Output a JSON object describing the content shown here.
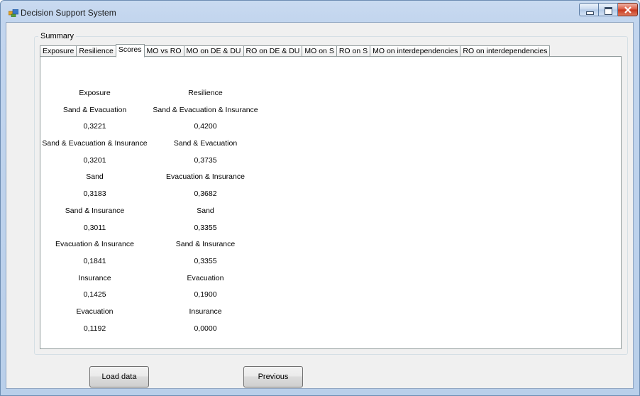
{
  "window": {
    "title": "Decision Support System"
  },
  "group": {
    "label": "Summary"
  },
  "tabs": [
    {
      "label": "Exposure"
    },
    {
      "label": "Resilience"
    },
    {
      "label": "Scores",
      "active": true
    },
    {
      "label": "MO vs RO"
    },
    {
      "label": "MO on DE & DU"
    },
    {
      "label": "RO on DE & DU"
    },
    {
      "label": "MO on S"
    },
    {
      "label": "RO on S"
    },
    {
      "label": "MO on interdependencies"
    },
    {
      "label": "RO on interdependencies"
    }
  ],
  "scores": {
    "exposure": {
      "header": "Exposure",
      "rows": [
        {
          "name": "Sand & Evacuation",
          "value": "0,3221"
        },
        {
          "name": "Sand & Evacuation & Insurance",
          "value": "0,3201"
        },
        {
          "name": "Sand",
          "value": "0,3183"
        },
        {
          "name": "Sand & Insurance",
          "value": "0,3011"
        },
        {
          "name": "Evacuation & Insurance",
          "value": "0,1841"
        },
        {
          "name": "Insurance",
          "value": "0,1425"
        },
        {
          "name": "Evacuation",
          "value": "0,1192"
        }
      ]
    },
    "resilience": {
      "header": "Resilience",
      "rows": [
        {
          "name": "Sand & Evacuation & Insurance",
          "value": "0,4200"
        },
        {
          "name": "Sand & Evacuation",
          "value": "0,3735"
        },
        {
          "name": "Evacuation & Insurance",
          "value": "0,3682"
        },
        {
          "name": "Sand",
          "value": "0,3355"
        },
        {
          "name": "Sand & Insurance",
          "value": "0,3355"
        },
        {
          "name": "Evacuation",
          "value": "0,1900"
        },
        {
          "name": "Insurance",
          "value": "0,0000"
        }
      ]
    }
  },
  "buttons": {
    "load": "Load data",
    "previous": "Previous"
  }
}
